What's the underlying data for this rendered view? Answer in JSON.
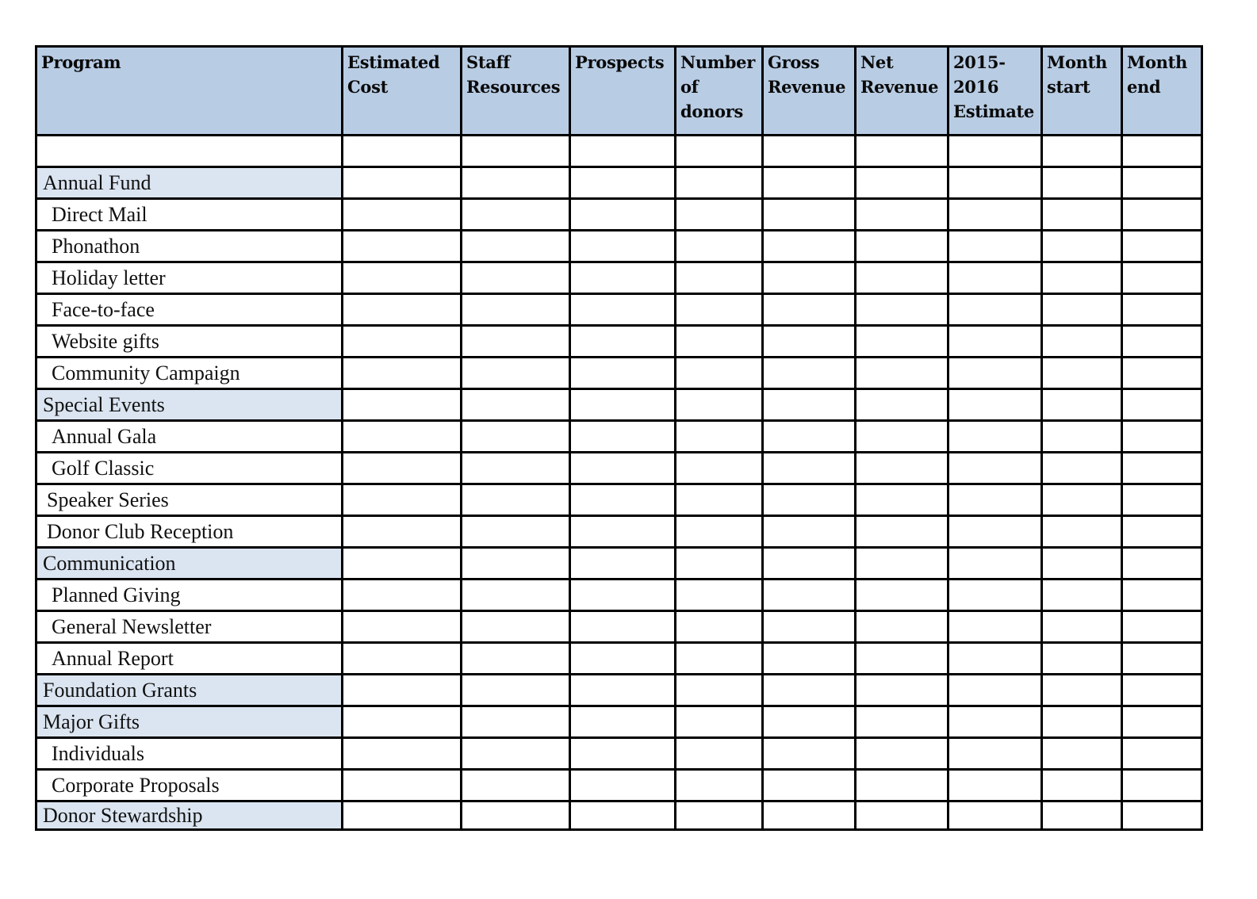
{
  "table": {
    "columns": [
      "Program",
      "Estimated Cost",
      "Staff Resources",
      "Prospects",
      "Number of donors",
      "Gross Revenue",
      "Net Revenue",
      "2015-2016 Estimate",
      "Month start",
      "Month end"
    ],
    "header_lines": [
      [
        "Program"
      ],
      [
        "Estimated",
        "Cost"
      ],
      [
        "Staff",
        "Resources"
      ],
      [
        "Prospects"
      ],
      [
        "Number",
        "of",
        "donors"
      ],
      [
        "Gross",
        "Revenue"
      ],
      [
        "Net",
        "Revenue"
      ],
      [
        "2015-",
        "2016",
        "Estimate"
      ],
      [
        "Month",
        "start"
      ],
      [
        "Month",
        "end"
      ]
    ],
    "rows": [
      {
        "label": "",
        "type": "blank"
      },
      {
        "label": "Annual Fund",
        "type": "section"
      },
      {
        "label": "Direct Mail",
        "type": "item"
      },
      {
        "label": "Phonathon",
        "type": "item"
      },
      {
        "label": "Holiday letter",
        "type": "item"
      },
      {
        "label": "Face-to-face",
        "type": "item"
      },
      {
        "label": "Website gifts",
        "type": "item"
      },
      {
        "label": "Community Campaign",
        "type": "item"
      },
      {
        "label": "Special Events",
        "type": "section"
      },
      {
        "label": "Annual Gala",
        "type": "item"
      },
      {
        "label": "Golf Classic",
        "type": "item"
      },
      {
        "label": "Speaker Series",
        "type": "item-outdent"
      },
      {
        "label": "Donor Club Reception",
        "type": "item-outdent"
      },
      {
        "label": "Communication",
        "type": "section"
      },
      {
        "label": "Planned Giving",
        "type": "item"
      },
      {
        "label": "General Newsletter",
        "type": "item"
      },
      {
        "label": "Annual Report",
        "type": "item"
      },
      {
        "label": "Foundation Grants",
        "type": "section"
      },
      {
        "label": "Major Gifts",
        "type": "section"
      },
      {
        "label": "Individuals",
        "type": "item"
      },
      {
        "label": "Corporate Proposals",
        "type": "item"
      },
      {
        "label": "Donor Stewardship",
        "type": "section"
      }
    ]
  },
  "colors": {
    "header_fill": "#b8cce4",
    "section_fill": "#dbe5f1",
    "border": "#000000"
  }
}
